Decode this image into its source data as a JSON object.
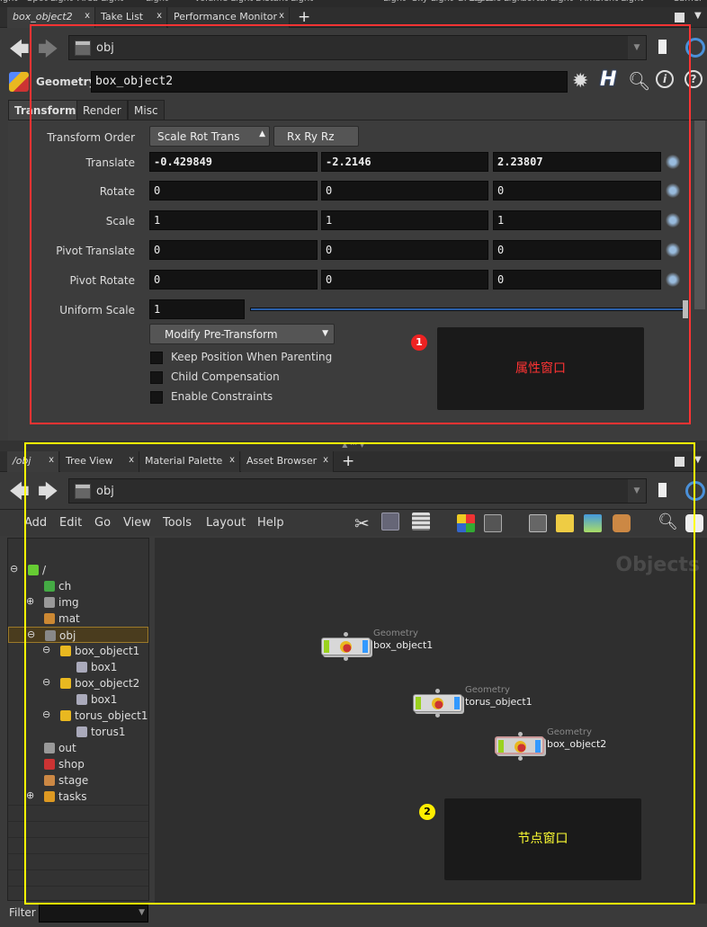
{
  "shelf": [
    "ight",
    "Spot Light",
    "Area Light",
    "Light",
    "Volume Light",
    "Distant Light",
    "Light",
    "Sky Light",
    "GI Light",
    "Caustic Light",
    "Portal Light",
    "Ambient Light",
    "Camer"
  ],
  "top_tabs": [
    {
      "label": "box_object2"
    },
    {
      "label": "Take List"
    },
    {
      "label": "Performance Monitor"
    }
  ],
  "tab_close": "x",
  "plus": "+",
  "top_path": "obj",
  "params": {
    "node_type": "Geometry",
    "node_name": "box_object2",
    "tabs": [
      "Transform",
      "Render",
      "Misc"
    ],
    "transform_order_label": "Transform Order",
    "transform_order": "Scale Rot Trans",
    "rot_order": "Rx Ry Rz",
    "rows": [
      {
        "label": "Translate",
        "values": [
          "-0.429849",
          "-2.2146",
          "2.23807"
        ]
      },
      {
        "label": "Rotate",
        "values": [
          "0",
          "0",
          "0"
        ]
      },
      {
        "label": "Scale",
        "values": [
          "1",
          "1",
          "1"
        ]
      },
      {
        "label": "Pivot Translate",
        "values": [
          "0",
          "0",
          "0"
        ]
      },
      {
        "label": "Pivot Rotate",
        "values": [
          "0",
          "0",
          "0"
        ]
      }
    ],
    "uniform_scale_label": "Uniform Scale",
    "uniform_scale": "1",
    "modify_pre_transform": "Modify Pre-Transform",
    "checkboxes": [
      {
        "label": "Keep Position When Parenting",
        "checked": false
      },
      {
        "label": "Child Compensation",
        "checked": false
      },
      {
        "label": "Enable Constraints",
        "checked": false
      }
    ]
  },
  "annotation1": {
    "badge": "1",
    "text": "属性窗口",
    "color": "#ff3333"
  },
  "bottom_tabs": [
    {
      "label": "/obj"
    },
    {
      "label": "Tree View"
    },
    {
      "label": "Material Palette"
    },
    {
      "label": "Asset Browser"
    }
  ],
  "bottom_path": "obj",
  "menu": [
    "Add",
    "Edit",
    "Go",
    "View",
    "Tools",
    "Layout",
    "Help"
  ],
  "tree": [
    {
      "label": "/",
      "depth": 0,
      "exp": "-",
      "color": "#6c3"
    },
    {
      "label": "ch",
      "depth": 1,
      "exp": "",
      "color": "#4a4"
    },
    {
      "label": "img",
      "depth": 1,
      "exp": "+",
      "color": "#999"
    },
    {
      "label": "mat",
      "depth": 1,
      "exp": "",
      "color": "#c83"
    },
    {
      "label": "obj",
      "depth": 1,
      "exp": "-",
      "color": "#888",
      "selected": true
    },
    {
      "label": "box_object1",
      "depth": 2,
      "exp": "-",
      "color": "#e9b820"
    },
    {
      "label": "box1",
      "depth": 3,
      "exp": "",
      "color": "#aab"
    },
    {
      "label": "box_object2",
      "depth": 2,
      "exp": "-",
      "color": "#e9b820"
    },
    {
      "label": "box1",
      "depth": 3,
      "exp": "",
      "color": "#aab"
    },
    {
      "label": "torus_object1",
      "depth": 2,
      "exp": "-",
      "color": "#e9b820"
    },
    {
      "label": "torus1",
      "depth": 3,
      "exp": "",
      "color": "#aab"
    },
    {
      "label": "out",
      "depth": 1,
      "exp": "",
      "color": "#999"
    },
    {
      "label": "shop",
      "depth": 1,
      "exp": "",
      "color": "#c33"
    },
    {
      "label": "stage",
      "depth": 1,
      "exp": "",
      "color": "#c84"
    },
    {
      "label": "tasks",
      "depth": 1,
      "exp": "+",
      "color": "#d92"
    }
  ],
  "network": {
    "context_label": "Objects",
    "nodes": [
      {
        "type": "Geometry",
        "name": "box_object1",
        "selected": false
      },
      {
        "type": "Geometry",
        "name": "torus_object1",
        "selected": false
      },
      {
        "type": "Geometry",
        "name": "box_object2",
        "selected": true
      }
    ]
  },
  "annotation2": {
    "badge": "2",
    "text": "节点窗口",
    "color": "#ffff00"
  },
  "filter_label": "Filter"
}
